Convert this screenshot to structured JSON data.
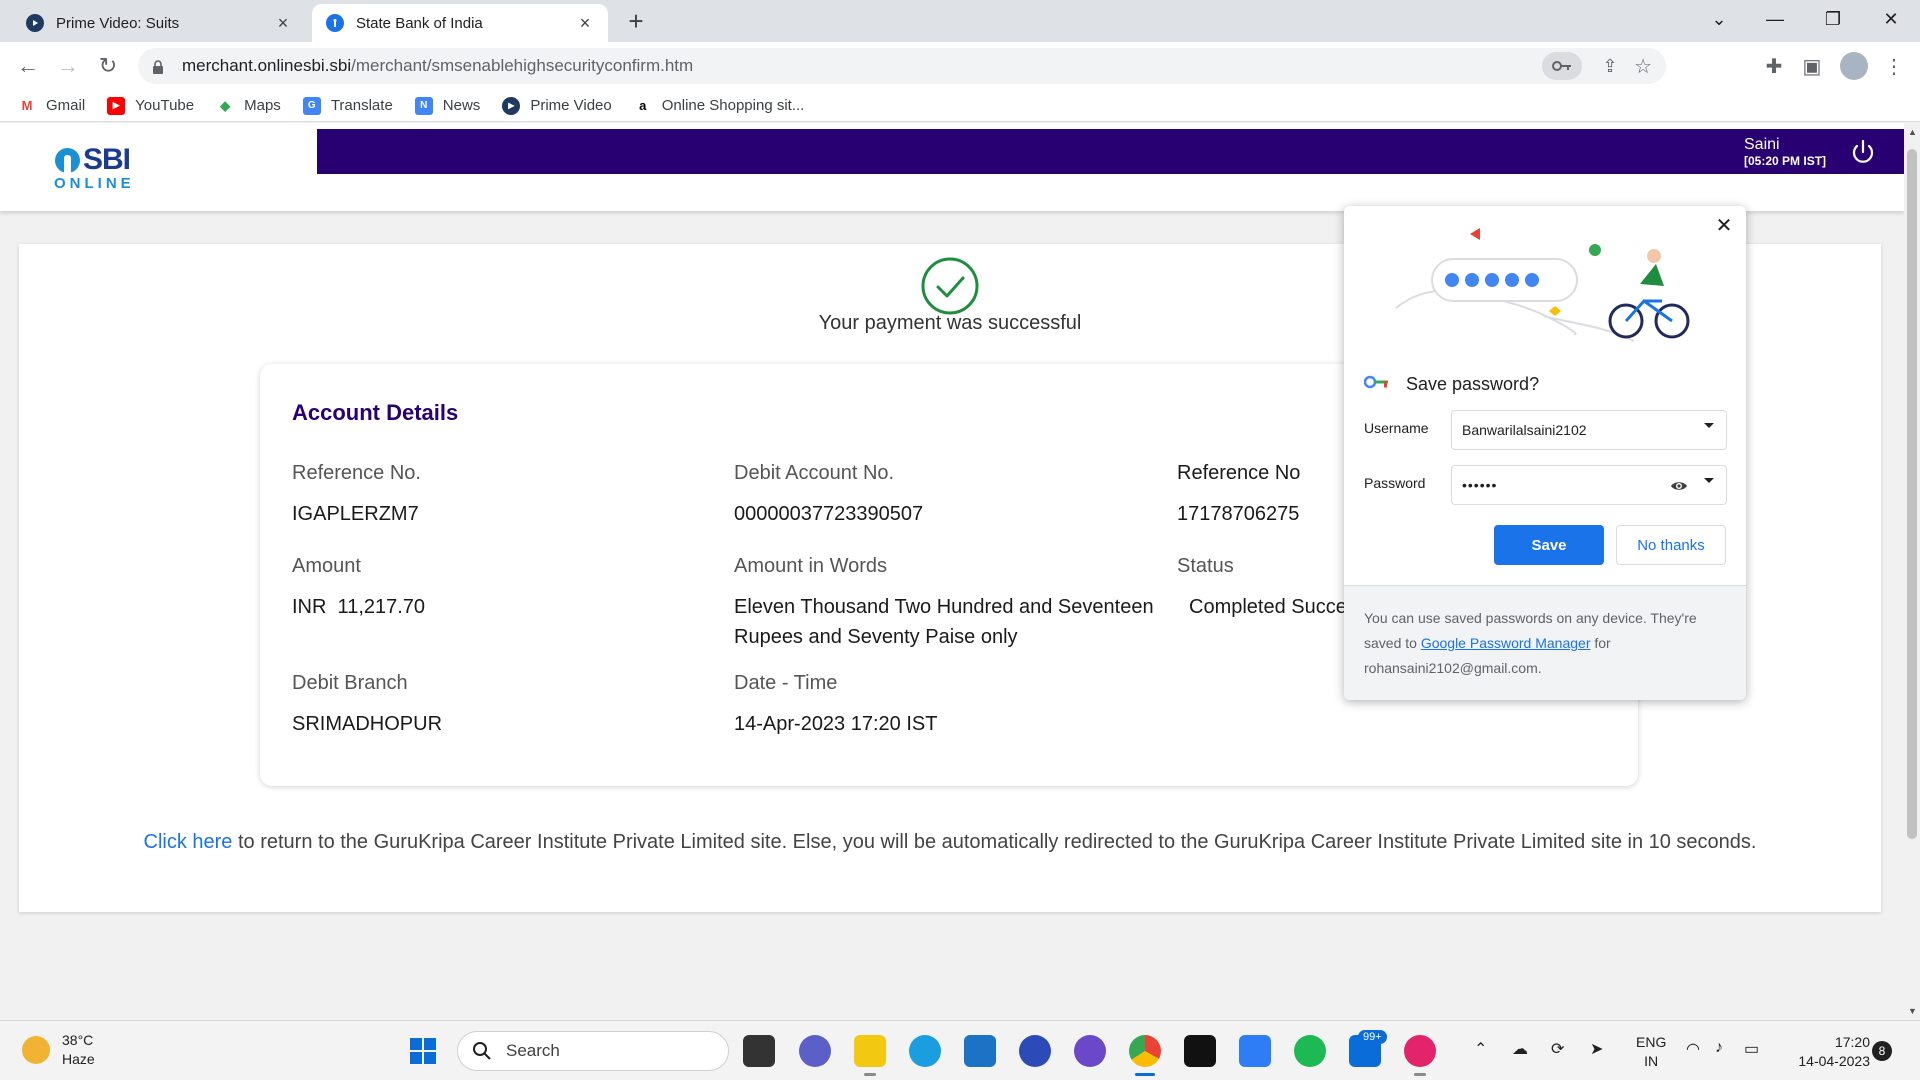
{
  "tabs": [
    {
      "title": "Prime Video: Suits"
    },
    {
      "title": "State Bank of India"
    }
  ],
  "address": {
    "domain": "merchant.onlinesbi.sbi",
    "path": "/merchant/smsenablehighsecurityconfirm.htm"
  },
  "bookmarks": [
    {
      "label": "Gmail",
      "icon": "gmail-icon"
    },
    {
      "label": "YouTube",
      "icon": "youtube-icon"
    },
    {
      "label": "Maps",
      "icon": "maps-icon"
    },
    {
      "label": "Translate",
      "icon": "translate-icon"
    },
    {
      "label": "News",
      "icon": "news-icon"
    },
    {
      "label": "Prime Video",
      "icon": "prime-video-icon"
    },
    {
      "label": "Online Shopping sit...",
      "icon": "amazon-icon"
    }
  ],
  "sbi": {
    "logo_main": "SBI",
    "logo_sub": "ONLINE",
    "user_name": "Saini",
    "user_time": "[05:20 PM IST]",
    "brand_color": "#280071"
  },
  "payment": {
    "status_message": "Your payment was successful",
    "section_title": "Account Details",
    "fields": {
      "reference_no": {
        "label": "Reference No.",
        "value": "IGAPLERZM7"
      },
      "debit_account": {
        "label": "Debit Account No.",
        "value": "00000037723390507"
      },
      "reference_no_2": {
        "label": "Reference No",
        "value": "17178706275"
      },
      "amount": {
        "label": "Amount",
        "value": "INR  11,217.70"
      },
      "amount_words": {
        "label": "Amount in Words",
        "value": "Eleven Thousand Two Hundred and Seventeen Rupees and Seventy Paise only"
      },
      "status": {
        "label": "Status",
        "value": "Completed Successfully"
      },
      "debit_branch": {
        "label": "Debit Branch",
        "value": "SRIMADHOPUR"
      },
      "date_time": {
        "label": "Date - Time",
        "value": "14-Apr-2023 17:20 IST"
      }
    },
    "redirect_link": "Click here",
    "redirect_text": " to return to the GuruKripa Career Institute Private Limited site. Else, you will be automatically redirected to the GuruKripa Career Institute Private Limited site in 10 seconds."
  },
  "password_popup": {
    "title": "Save password?",
    "username_label": "Username",
    "username_value": "Banwarilalsaini2102",
    "password_label": "Password",
    "password_value": "••••••",
    "save_label": "Save",
    "no_thanks_label": "No thanks",
    "footer_text_1": "You can use saved passwords on any device. They're saved to ",
    "footer_link": "Google Password Manager",
    "footer_text_2": " for rohansaini2102@gmail.com."
  },
  "taskbar": {
    "temperature": "38°C",
    "weather": "Haze",
    "search_label": "Search",
    "badge": "99+",
    "lang_1": "ENG",
    "lang_2": "IN",
    "time": "17:20",
    "date": "14-04-2023",
    "notifications": "8"
  }
}
